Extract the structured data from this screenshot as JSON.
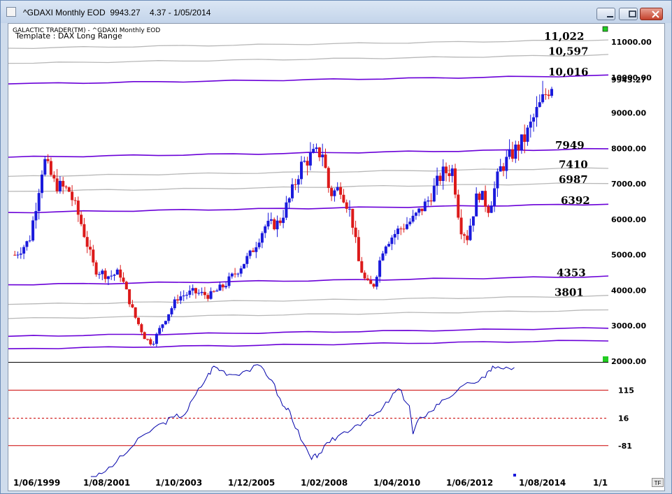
{
  "window": {
    "title": "^GDAXI Monthly EOD  9943.27    4.37 - 1/05/2014",
    "minimize_label": "minimize",
    "maximize_label": "maximize",
    "close_label": "close"
  },
  "chart_header": {
    "line1": "GALACTIC TRADER(TM)  -  ^GDAXI Monthly EOD",
    "line2": "Template : DAX Long Range"
  },
  "badge": "TF",
  "colors": {
    "purple_level": "#6a00d8",
    "gray_level": "#b8b8b8",
    "candle_up": "#1a1adc",
    "candle_down": "#dc1a1a",
    "osc_line": "#0000aa",
    "osc_ref": "#cc0000",
    "marker_green": "#22cc22"
  },
  "chart_data": [
    {
      "type": "candlestick",
      "title": "^GDAXI Monthly EOD",
      "y_axis_ticks": [
        "11000.00",
        "10000.00",
        "9000.00",
        "8000.00",
        "7000.00",
        "6000.00",
        "5000.00",
        "4000.00",
        "3000.00",
        "2000.00"
      ],
      "y_ticks_values": [
        11000,
        10000,
        9000,
        8000,
        7000,
        6000,
        5000,
        4000,
        3000,
        2000
      ],
      "ylim": [
        2000,
        11000
      ],
      "last_price_label": "9943.27",
      "last_price": 9943.27,
      "x_axis_ticks": [
        "1/06/1999",
        "1/08/2001",
        "1/10/2003",
        "1/12/2005",
        "1/02/2008",
        "1/04/2010",
        "1/06/2012",
        "1/08/2014",
        "1/1"
      ],
      "level_lines": [
        {
          "label": "11,022",
          "value": 11022,
          "color": "gray"
        },
        {
          "label": "10,597",
          "value": 10597,
          "color": "gray"
        },
        {
          "label": "10,016",
          "value": 10016,
          "color": "purple"
        },
        {
          "label": "7949",
          "value": 7949,
          "color": "purple"
        },
        {
          "label": "7410",
          "value": 7410,
          "color": "gray"
        },
        {
          "label": "6987",
          "value": 6987,
          "color": "gray"
        },
        {
          "label": "6392",
          "value": 6392,
          "color": "purple"
        },
        {
          "label": "4353",
          "value": 4353,
          "color": "purple"
        },
        {
          "label": "3801",
          "value": 3801,
          "color": "gray"
        }
      ],
      "unlabeled_levels": [
        {
          "value": 3400,
          "color": "gray"
        },
        {
          "value": 2900,
          "color": "purple"
        },
        {
          "value": 2550,
          "color": "purple"
        }
      ],
      "price_path": [
        [
          1999.4,
          5000
        ],
        [
          1999.8,
          5400
        ],
        [
          2000.0,
          6500
        ],
        [
          2000.2,
          7700
        ],
        [
          2000.5,
          7000
        ],
        [
          2000.9,
          6800
        ],
        [
          2001.2,
          6000
        ],
        [
          2001.6,
          4600
        ],
        [
          2002.0,
          4400
        ],
        [
          2002.3,
          4500
        ],
        [
          2002.7,
          3300
        ],
        [
          2003.0,
          2650
        ],
        [
          2003.2,
          2500
        ],
        [
          2003.5,
          3100
        ],
        [
          2003.9,
          3800
        ],
        [
          2004.3,
          3950
        ],
        [
          2004.8,
          3850
        ],
        [
          2005.2,
          4150
        ],
        [
          2005.5,
          4500
        ],
        [
          2005.9,
          5000
        ],
        [
          2006.3,
          5800
        ],
        [
          2006.7,
          5900
        ],
        [
          2007.0,
          6600
        ],
        [
          2007.3,
          7500
        ],
        [
          2007.6,
          7800
        ],
        [
          2007.9,
          7900
        ],
        [
          2008.1,
          6700
        ],
        [
          2008.4,
          6900
        ],
        [
          2008.7,
          6100
        ],
        [
          2008.9,
          4800
        ],
        [
          2009.1,
          4200
        ],
        [
          2009.3,
          4100
        ],
        [
          2009.6,
          5300
        ],
        [
          2010.0,
          5700
        ],
        [
          2010.4,
          6000
        ],
        [
          2010.8,
          6500
        ],
        [
          2011.2,
          7300
        ],
        [
          2011.5,
          7400
        ],
        [
          2011.7,
          5800
        ],
        [
          2011.9,
          5500
        ],
        [
          2012.2,
          6800
        ],
        [
          2012.5,
          6300
        ],
        [
          2012.8,
          7400
        ],
        [
          2013.1,
          7800
        ],
        [
          2013.5,
          8300
        ],
        [
          2013.8,
          9000
        ],
        [
          2014.1,
          9600
        ],
        [
          2014.3,
          9943
        ]
      ]
    },
    {
      "type": "line",
      "title": "oscillator",
      "y_axis_ticks": [
        "115",
        "16",
        "-81"
      ],
      "reference_lines": [
        115,
        16,
        -81
      ],
      "ylim": [
        -210,
        210
      ],
      "x_start": 1999.3,
      "x_end": 2014.6,
      "points": [
        [
          2001.5,
          -210
        ],
        [
          2001.8,
          -180
        ],
        [
          2002.2,
          -140
        ],
        [
          2002.6,
          -90
        ],
        [
          2003.0,
          -40
        ],
        [
          2003.5,
          0
        ],
        [
          2003.8,
          20
        ],
        [
          2004.1,
          30
        ],
        [
          2004.4,
          100
        ],
        [
          2004.7,
          160
        ],
        [
          2004.9,
          200
        ],
        [
          2005.1,
          185
        ],
        [
          2005.4,
          170
        ],
        [
          2005.8,
          185
        ],
        [
          2006.2,
          200
        ],
        [
          2006.5,
          150
        ],
        [
          2006.8,
          60
        ],
        [
          2007.0,
          40
        ],
        [
          2007.3,
          -60
        ],
        [
          2007.6,
          -130
        ],
        [
          2007.8,
          -110
        ],
        [
          2008.1,
          -70
        ],
        [
          2008.4,
          -40
        ],
        [
          2008.8,
          -10
        ],
        [
          2009.1,
          10
        ],
        [
          2009.5,
          40
        ],
        [
          2009.8,
          90
        ],
        [
          2010.0,
          120
        ],
        [
          2010.3,
          60
        ],
        [
          2010.4,
          -40
        ],
        [
          2010.6,
          20
        ],
        [
          2010.9,
          40
        ],
        [
          2011.2,
          80
        ],
        [
          2011.6,
          110
        ],
        [
          2012.0,
          140
        ],
        [
          2012.4,
          160
        ],
        [
          2012.6,
          200
        ],
        [
          2012.9,
          190
        ],
        [
          2013.2,
          195
        ]
      ]
    }
  ]
}
